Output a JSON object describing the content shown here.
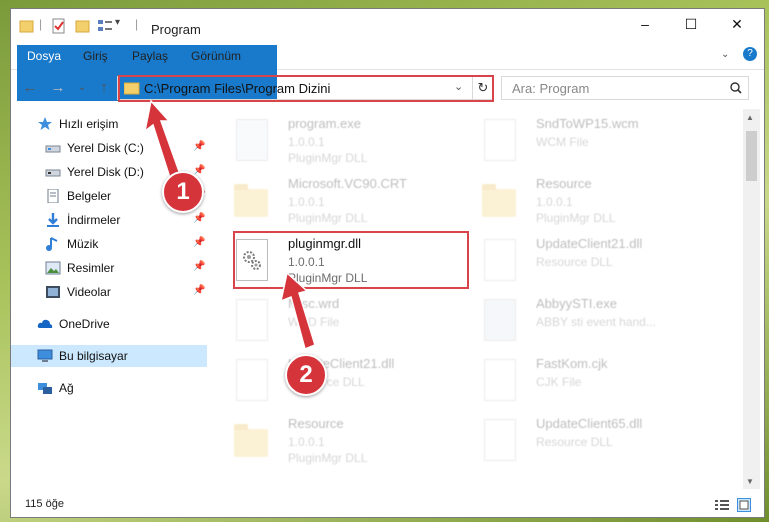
{
  "window": {
    "title": "Program",
    "controls": [
      "–",
      "☐",
      "✕"
    ]
  },
  "ribbon": {
    "tabs": [
      "Dosya",
      "Giriş",
      "Paylaş",
      "Görünüm"
    ],
    "help": "?"
  },
  "nav": {
    "address": "C:\\Program Files\\Program Dizini",
    "search_placeholder": "Ara: Program"
  },
  "sidebar": {
    "items": [
      {
        "label": "Hızlı erişim",
        "icon": "star-icon"
      },
      {
        "label": "Yerel Disk (C:)",
        "icon": "drive-icon",
        "pinned": true
      },
      {
        "label": "Yerel Disk (D:)",
        "icon": "drive-icon",
        "pinned": true
      },
      {
        "label": "Belgeler",
        "icon": "documents-icon",
        "pinned": true
      },
      {
        "label": "İndirmeler",
        "icon": "download-icon",
        "pinned": true
      },
      {
        "label": "Müzik",
        "icon": "music-icon",
        "pinned": true
      },
      {
        "label": "Resimler",
        "icon": "pictures-icon",
        "pinned": true
      },
      {
        "label": "Videolar",
        "icon": "videos-icon",
        "pinned": true
      },
      {
        "label": "OneDrive",
        "icon": "cloud-icon"
      },
      {
        "label": "Bu bilgisayar",
        "icon": "computer-icon",
        "selected": true
      },
      {
        "label": "Ağ",
        "icon": "network-icon"
      }
    ]
  },
  "files": [
    {
      "name": "program.exe",
      "line1": "1.0.0.1",
      "line2": "PluginMgr DLL",
      "icon": "exe-icon"
    },
    {
      "name": "SndToWP15.wcm",
      "line1": "WCM File",
      "line2": "",
      "icon": "document-icon"
    },
    {
      "name": "Microsoft.VC90.CRT",
      "line1": "1.0.0.1",
      "line2": "PluginMgr DLL",
      "icon": "folder-icon"
    },
    {
      "name": "Resource",
      "line1": "1.0.0.1",
      "line2": "PluginMgr DLL",
      "icon": "folder-icon"
    },
    {
      "name": "pluginmgr.dll",
      "line1": "1.0.0.1",
      "line2": "PluginMgr DLL",
      "icon": "dll-gear-icon",
      "highlighted": true
    },
    {
      "name": "UpdateClient21.dll",
      "line1": "Resource DLL",
      "line2": "",
      "icon": "dll-gear-icon"
    },
    {
      "name": "Misc.wrd",
      "line1": "WRD File",
      "line2": "",
      "icon": "document-icon"
    },
    {
      "name": "AbbyySTI.exe",
      "line1": "ABBY sti event hand...",
      "line2": "",
      "icon": "exe-icon"
    },
    {
      "name": "UpdateClient21.dll",
      "line1": "Resource DLL",
      "line2": "",
      "icon": "dll-gear-icon"
    },
    {
      "name": "FastKom.cjk",
      "line1": "CJK File",
      "line2": "",
      "icon": "document-icon"
    },
    {
      "name": "Resource",
      "line1": "1.0.0.1",
      "line2": "PluginMgr DLL",
      "icon": "folder-icon"
    },
    {
      "name": "UpdateClient65.dll",
      "line1": "Resource DLL",
      "line2": "",
      "icon": "dll-gear-icon"
    }
  ],
  "status": {
    "count": "115 öğe"
  },
  "annotations": {
    "step1": "1",
    "step2": "2",
    "color": "#d6343b"
  }
}
